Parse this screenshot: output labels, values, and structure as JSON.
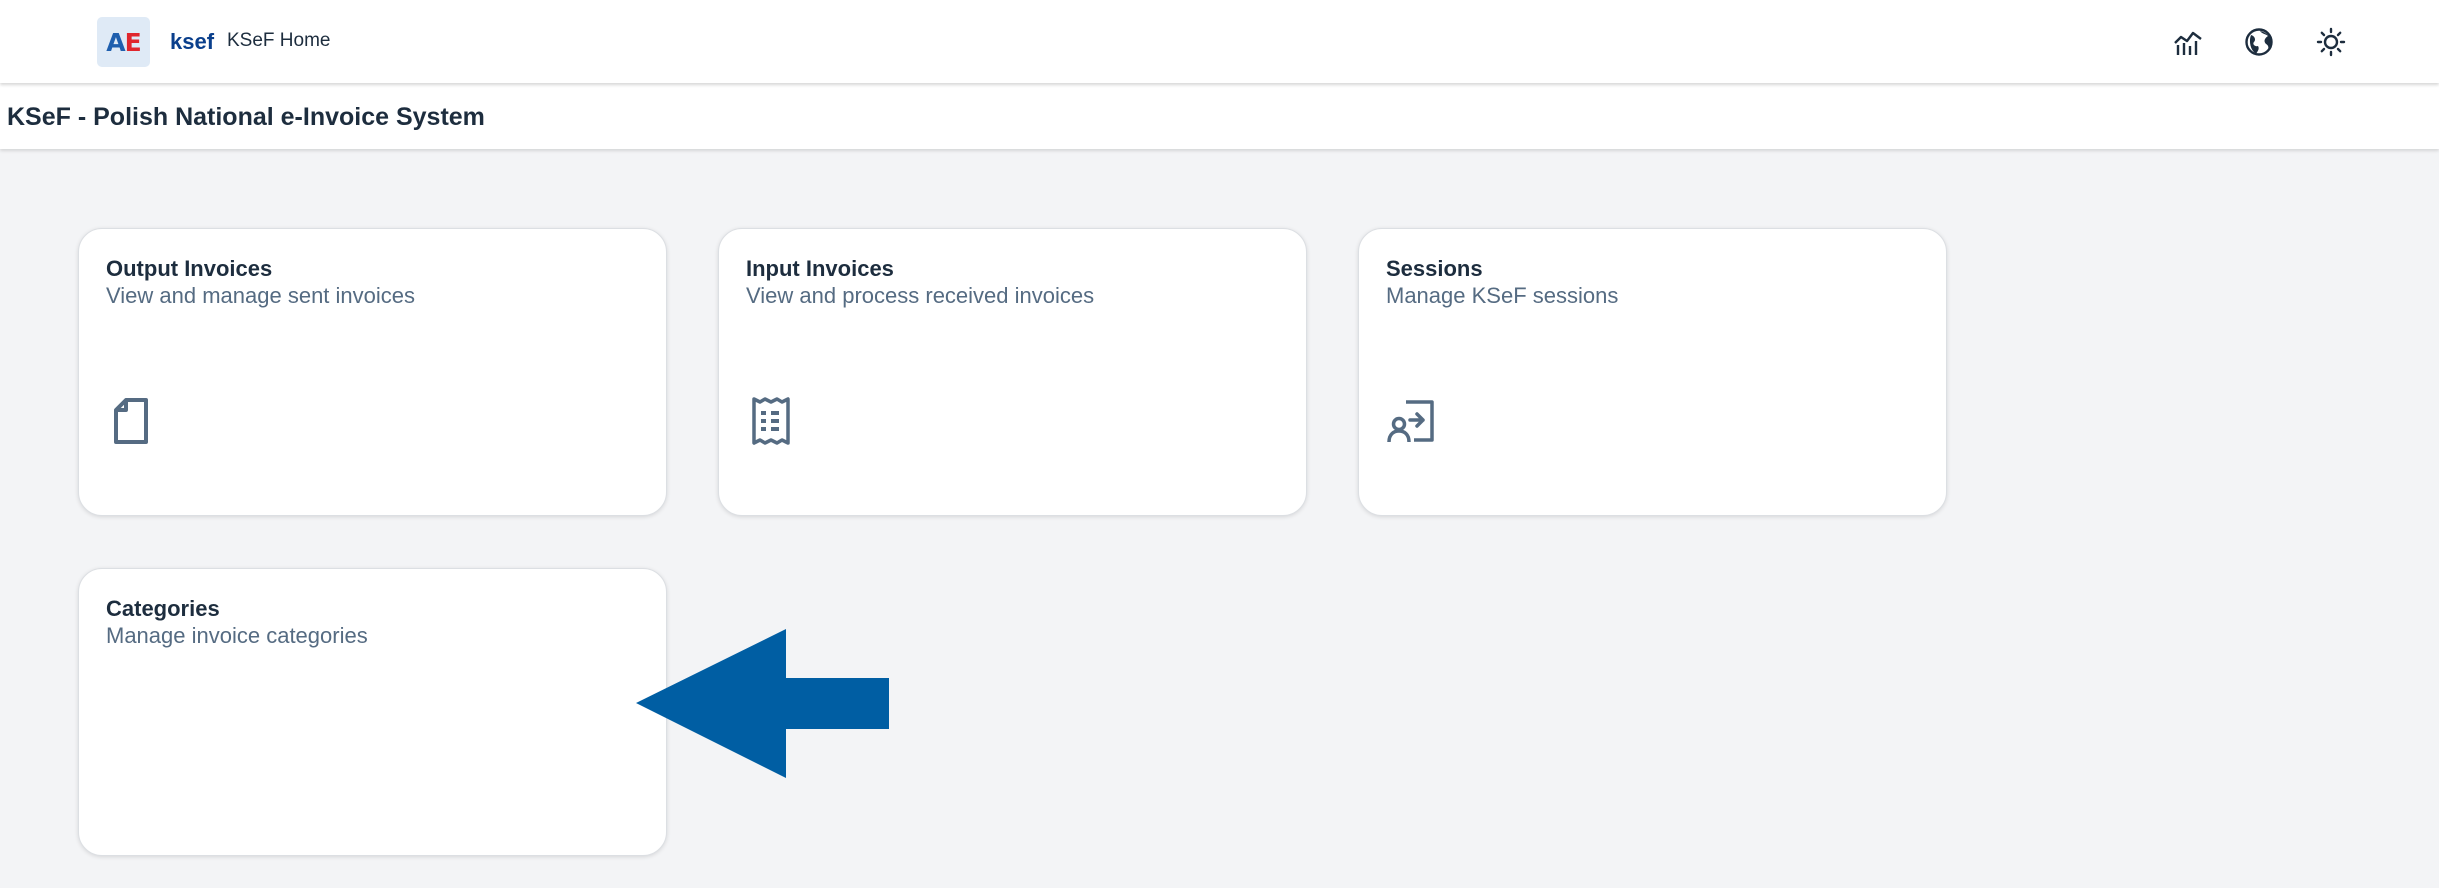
{
  "shell": {
    "logo": {
      "left": "A",
      "right": "E"
    },
    "product": "ksef",
    "home_title": "KSeF Home",
    "actions": [
      "analytics-icon",
      "globe-icon",
      "theme-sun-icon"
    ]
  },
  "page": {
    "title": "KSeF - Polish National e-Invoice System"
  },
  "tiles": [
    {
      "title": "Output Invoices",
      "subtitle": "View and manage sent invoices",
      "icon": "document-icon"
    },
    {
      "title": "Input Invoices",
      "subtitle": "View and process received invoices",
      "icon": "receipt-icon"
    },
    {
      "title": "Sessions",
      "subtitle": "Manage KSeF sessions",
      "icon": "user-login-icon"
    },
    {
      "title": "Categories",
      "subtitle": "Manage invoice categories",
      "icon": ""
    }
  ],
  "colors": {
    "brand": "#0a3f8c",
    "arrow": "#005ea3",
    "background": "#f3f4f6",
    "icon": "#556b82"
  }
}
